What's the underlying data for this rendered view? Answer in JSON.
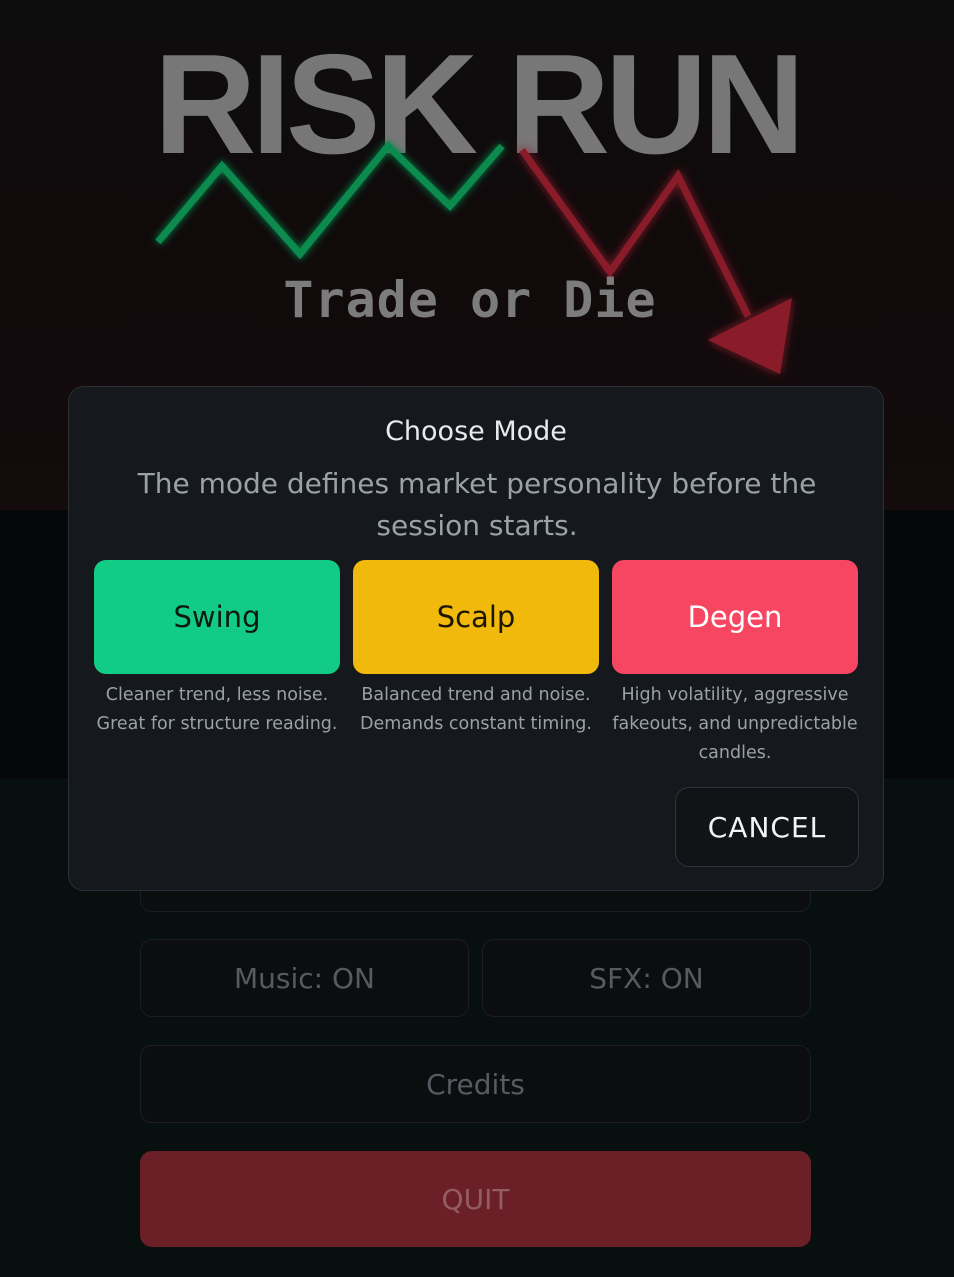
{
  "game": {
    "title": "RISK RUN",
    "tagline": "Trade or Die"
  },
  "menu": {
    "music_label": "Music: ON",
    "sfx_label": "SFX: ON",
    "credits_label": "Credits",
    "quit_label": "QUIT"
  },
  "modal": {
    "title": "Choose Mode",
    "description": "The mode defines market personality before the session starts.",
    "modes": [
      {
        "label": "Swing",
        "description": "Cleaner trend, less noise. Great for structure reading.",
        "color": "#12cc85"
      },
      {
        "label": "Scalp",
        "description": "Balanced trend and noise. Demands constant timing.",
        "color": "#f0b90b"
      },
      {
        "label": "Degen",
        "description": "High volatility, aggressive fakeouts, and unpredictable candles.",
        "color": "#f64661"
      }
    ],
    "cancel_label": "CANCEL"
  },
  "colors": {
    "up_line": "#0a8a4e",
    "down_line": "#8a1f2c",
    "quit": "#6b1f27"
  }
}
